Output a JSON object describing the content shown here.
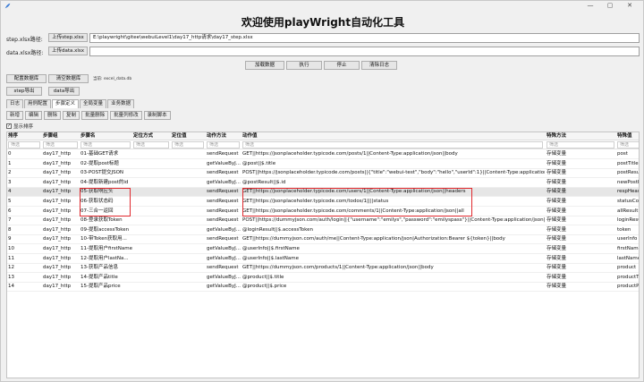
{
  "window": {
    "minimize": "—",
    "maximize": "▢",
    "close": "✕"
  },
  "title": "欢迎使用playWright自动化工具",
  "step_row": {
    "label": "step.xlsx路径:",
    "button": "上传step.xlsx",
    "path": "E:\\playwright\\gitee\\webuiLevel1\\day17_http请求\\day17_step.xlsx"
  },
  "data_row": {
    "label": "data.xlsx路径:",
    "button": "上传data.xlsx",
    "path": ""
  },
  "actions": {
    "load": "加载数据",
    "run": "执行",
    "stop": "停止",
    "clear_log": "清除日志"
  },
  "config": {
    "config_db": "配置数据库",
    "clear_db": "清空数据库",
    "db_note": "当前: excel_data.db"
  },
  "export": {
    "step": "step导出",
    "data": "data导出"
  },
  "tabs": [
    "日志",
    "用例配置",
    "步骤定义",
    "全局变量",
    "业务数据"
  ],
  "toolbar": [
    "新增",
    "编辑",
    "删除",
    "复制",
    "批量删除",
    "批量列修改",
    "录制脚本"
  ],
  "show_order": "显示排序",
  "checkmark": "✓",
  "columns": [
    "排序",
    "步骤组",
    "步骤名",
    "定位方式",
    "定位值",
    "动作方法",
    "动作值",
    "特殊方法",
    "特殊值"
  ],
  "filter_placeholder": "筛选",
  "rows": [
    [
      "0",
      "day17_http",
      "01-基础GET请求",
      "",
      "",
      "sendRequest",
      "GET||https://jsonplaceholder.typicode.com/posts/1||Content-Type:application/json||body",
      "存储变量",
      "post"
    ],
    [
      "1",
      "day17_http",
      "02-提取post标题",
      "",
      "",
      "getValueByJ...",
      "@post||$.title",
      "存储变量",
      "postTitle"
    ],
    [
      "2",
      "day17_http",
      "03-POST提交JSON",
      "",
      "",
      "sendRequest",
      "POST||https://jsonplaceholder.typicode.com/posts||{\"title\":\"webui-test\",\"body\":\"hello\",\"userId\":1}||Content-Type:application/json||body",
      "存储变量",
      "postResult"
    ],
    [
      "3",
      "day17_http",
      "04-提取新建post的id",
      "",
      "",
      "getValueByJ...",
      "@postResult||$.id",
      "存储变量",
      "newPostId"
    ],
    [
      "4",
      "day17_http",
      "05-获取响应头",
      "",
      "",
      "sendRequest",
      "GET||https://jsonplaceholder.typicode.com/users/1||Content-Type:application/json||headers",
      "存储变量",
      "respHeaders"
    ],
    [
      "5",
      "day17_http",
      "06-获取状态码",
      "",
      "",
      "sendRequest",
      "GET||https://jsonplaceholder.typicode.com/todos/1||||status",
      "存储变量",
      "statusCode"
    ],
    [
      "6",
      "day17_http",
      "07-三合一返回",
      "",
      "",
      "sendRequest",
      "GET||https://jsonplaceholder.typicode.com/comments/1||Content-Type:application/json||all",
      "存储变量",
      "allResult"
    ],
    [
      "7",
      "day17_http",
      "08-登录获取Token",
      "",
      "",
      "sendRequest",
      "POST||https://dummyjson.com/auth/login||{\"username\":\"emilys\",\"password\":\"emilyspass\"}||Content-Type:application/json||body",
      "存储变量",
      "loginResult"
    ],
    [
      "8",
      "day17_http",
      "09-提取accessToken",
      "",
      "",
      "getValueByJ...",
      "@loginResult||$.accessToken",
      "存储变量",
      "token"
    ],
    [
      "9",
      "day17_http",
      "10-带Token获取用...",
      "",
      "",
      "sendRequest",
      "GET||https://dummyjson.com/auth/me||Content-Type:application/json|Authorization:Bearer ${token}||body",
      "存储变量",
      "userInfo"
    ],
    [
      "10",
      "day17_http",
      "11-提取用户firstName",
      "",
      "",
      "getValueByJ...",
      "@userInfo||$.firstName",
      "存储变量",
      "firstName"
    ],
    [
      "11",
      "day17_http",
      "12-提取用户lastNa...",
      "",
      "",
      "getValueByJ...",
      "@userInfo||$.lastName",
      "存储变量",
      "lastName"
    ],
    [
      "12",
      "day17_http",
      "13-获取产品信息",
      "",
      "",
      "sendRequest",
      "GET||https://dummyjson.com/products/1||Content-Type:application/json||body",
      "存储变量",
      "product"
    ],
    [
      "13",
      "day17_http",
      "14-提取产品title",
      "",
      "",
      "getValueByJ...",
      "@product||$.title",
      "存储变量",
      "productTitle"
    ],
    [
      "14",
      "day17_http",
      "15-提取产品price",
      "",
      "",
      "getValueByJ...",
      "@product||$.price",
      "存储变量",
      "productPrice"
    ]
  ]
}
